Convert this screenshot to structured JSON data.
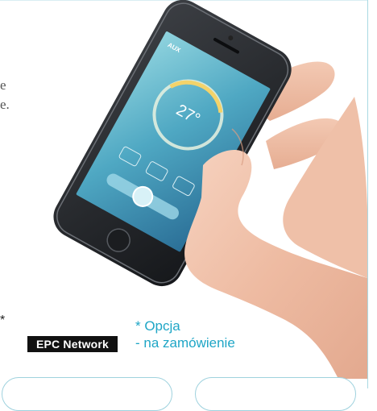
{
  "left_text": {
    "line1": "e",
    "line2": "e."
  },
  "phone_screen": {
    "logo": "AUX",
    "temperature": "27°",
    "buttons": [
      "",
      "",
      ""
    ]
  },
  "badge": {
    "asterisk": "*",
    "label": "EPC Network"
  },
  "option_note": {
    "line1": "* Opcja",
    "line2": "- na zamówienie"
  },
  "colors": {
    "accent": "#1fa6c6",
    "badge_bg": "#111111",
    "frame": "#a9d9e3"
  }
}
